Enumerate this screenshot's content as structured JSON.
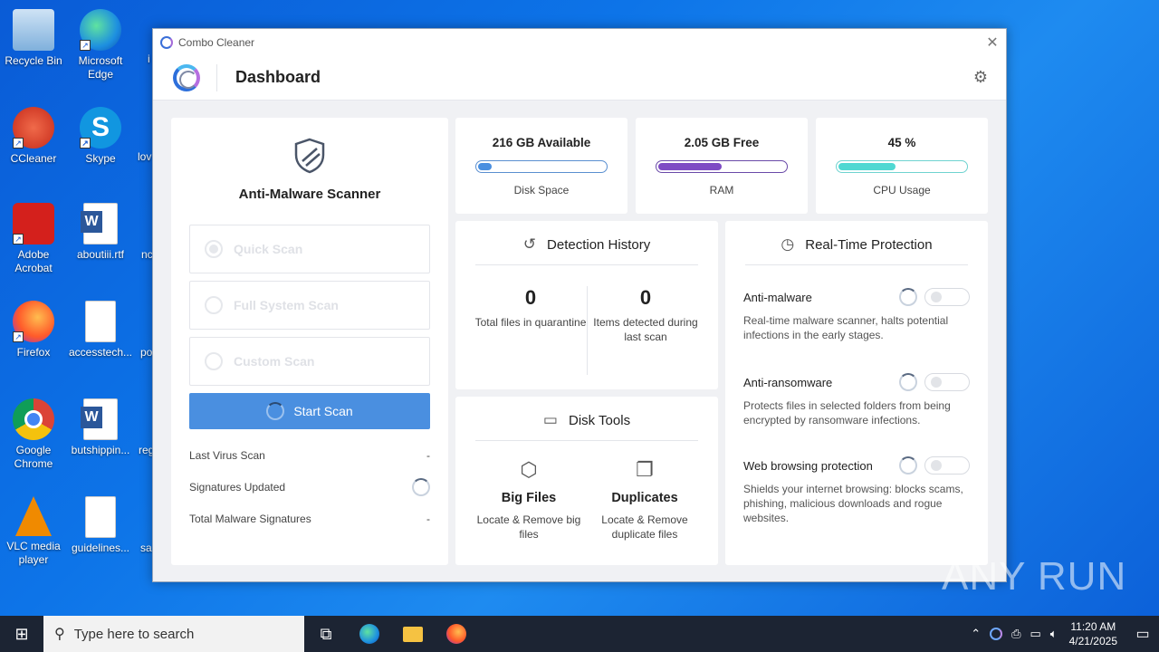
{
  "desktop": {
    "icons": [
      {
        "label": "Recycle Bin"
      },
      {
        "label": "Microsoft Edge"
      },
      {
        "label": "CCleaner"
      },
      {
        "label": "Skype"
      },
      {
        "label": "Adobe Acrobat"
      },
      {
        "label": "aboutiii.rtf"
      },
      {
        "label": "Firefox"
      },
      {
        "label": "accesstech..."
      },
      {
        "label": "Google Chrome"
      },
      {
        "label": "butshippin..."
      },
      {
        "label": "VLC media player"
      },
      {
        "label": "guidelines..."
      }
    ],
    "partials": [
      "i",
      "lov",
      "nc",
      "po",
      "reg",
      "sa"
    ]
  },
  "window": {
    "app_title": "Combo Cleaner",
    "close_glyph": "✕",
    "page_title": "Dashboard"
  },
  "scanner": {
    "title": "Anti-Malware Scanner",
    "options": [
      "Quick Scan",
      "Full System Scan",
      "Custom Scan"
    ],
    "start_label": "Start Scan",
    "rows": [
      {
        "label": "Last Virus Scan",
        "value": "-"
      },
      {
        "label": "Signatures Updated",
        "value": ""
      },
      {
        "label": "Total Malware Signatures",
        "value": "-"
      }
    ]
  },
  "stats": [
    {
      "value": "216 GB Available",
      "label": "Disk Space",
      "level": 0.12,
      "color": "#4a8fe0",
      "border": "#5a8fd0"
    },
    {
      "value": "2.05 GB Free",
      "label": "RAM",
      "level": 0.5,
      "color": "#7e4bc4",
      "border": "#6a4aa8"
    },
    {
      "value": "45 %",
      "label": "CPU Usage",
      "level": 0.45,
      "color": "#4fd8d2",
      "border": "#6fd3d0"
    }
  ],
  "history": {
    "title": "Detection History",
    "quarantine_count": "0",
    "quarantine_label": "Total files in quarantine",
    "detected_count": "0",
    "detected_label": "Items detected during last scan"
  },
  "disk_tools": {
    "title": "Disk Tools",
    "big_files": {
      "name": "Big Files",
      "desc": "Locate & Remove big files"
    },
    "duplicates": {
      "name": "Duplicates",
      "desc": "Locate & Remove duplicate files"
    }
  },
  "protection": {
    "title": "Real-Time Protection",
    "items": [
      {
        "name": "Anti-malware",
        "desc": "Real-time malware scanner, halts potential infections in the early stages."
      },
      {
        "name": "Anti-ransomware",
        "desc": "Protects files in selected folders from being encrypted by ransomware infections."
      },
      {
        "name": "Web browsing protection",
        "desc": "Shields your internet browsing: blocks scams, phishing, malicious downloads and rogue websites."
      }
    ]
  },
  "taskbar": {
    "search_placeholder": "Type here to search",
    "time": "11:20 AM",
    "date": "4/21/2025"
  },
  "watermark": "ANY RUN"
}
